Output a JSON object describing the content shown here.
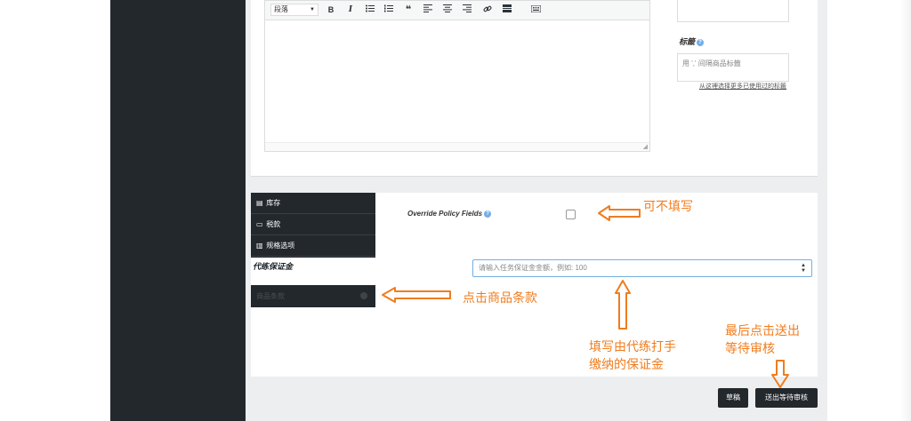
{
  "editor": {
    "format_select": "段落",
    "toolbar_buttons": [
      "bold",
      "italic",
      "bullet-list",
      "numbered-list",
      "blockquote",
      "align-left",
      "align-center",
      "align-right",
      "link",
      "read-more",
      "toolbar-toggle"
    ],
    "bold_label": "B",
    "italic_label": "I",
    "quote_label": "❝"
  },
  "tags": {
    "title": "标籤",
    "help": "?",
    "placeholder": "用 ',' 间隔商品标籤",
    "choose_link": "从这裡选择更多已使用过的标籤"
  },
  "product_tabs": [
    {
      "label": "库存",
      "icon": "box-icon"
    },
    {
      "label": "税款",
      "icon": "money-icon"
    },
    {
      "label": "规格选项",
      "icon": "list-icon"
    }
  ],
  "terms_tab": {
    "label": "商品条款"
  },
  "policy": {
    "label": "Override Policy Fields",
    "help": "?"
  },
  "deposit": {
    "label": "代练保证金",
    "placeholder": "请输入任务保证金金额，例如: 100"
  },
  "buttons": {
    "draft": "草稿",
    "submit": "送出等待审核"
  },
  "annotations": {
    "optional": "可不填写",
    "click_terms": "点击商品条款",
    "fill_deposit_line1": "填写由代练打手",
    "fill_deposit_line2": "缴纳的保证金",
    "final_line1": "最后点击送出",
    "final_line2": "等待审核"
  },
  "colors": {
    "annotation": "#f07c1e",
    "dark": "#23282d",
    "focus_border": "#72aee6"
  }
}
